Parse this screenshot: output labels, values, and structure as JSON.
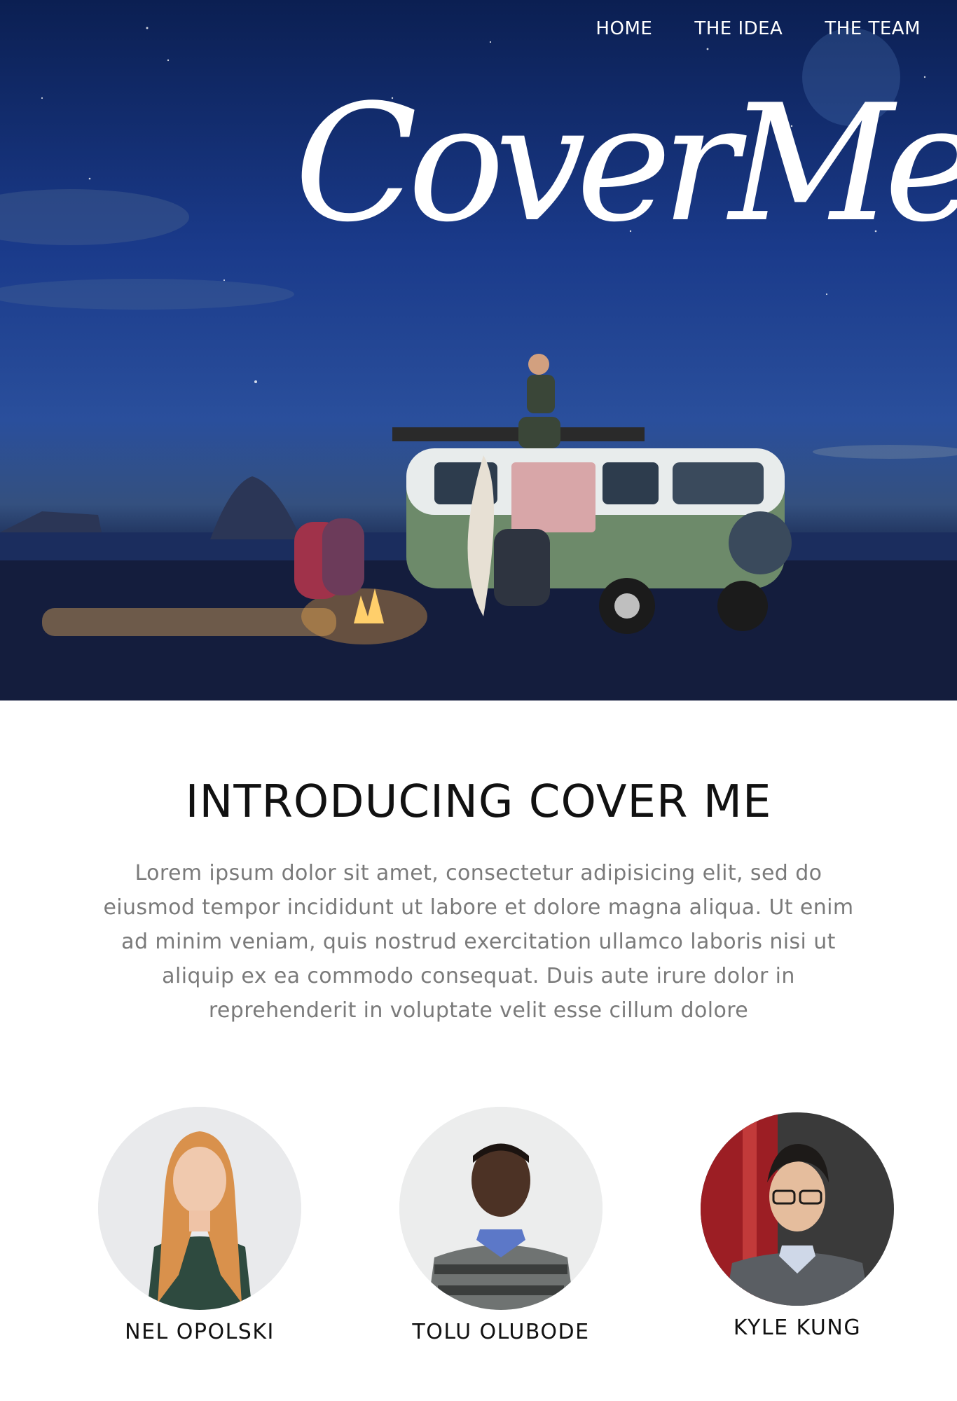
{
  "nav": {
    "home": "HOME",
    "idea": "THE IDEA",
    "team": "THE TEAM"
  },
  "hero": {
    "logo_text": "CoverMe"
  },
  "intro": {
    "title": "INTRODUCING COVER ME",
    "body": "Lorem ipsum dolor sit amet, consectetur adipisicing elit, sed do eiusmod tempor incididunt ut labore et dolore magna aliqua. Ut enim ad minim veniam, quis nostrud exercitation ullamco laboris nisi ut aliquip ex ea commodo consequat. Duis aute irure dolor in reprehenderit in voluptate velit esse cillum dolore"
  },
  "team": [
    {
      "name": "NEL OPOLSKI"
    },
    {
      "name": "TOLU OLUBODE"
    },
    {
      "name": "KYLE KUNG"
    }
  ],
  "colors": {
    "sky_top": "#0b1f52",
    "sky_mid": "#2a4f9c",
    "sand": "#10193a",
    "heading": "#111111",
    "body_text": "#7a7a7a"
  }
}
